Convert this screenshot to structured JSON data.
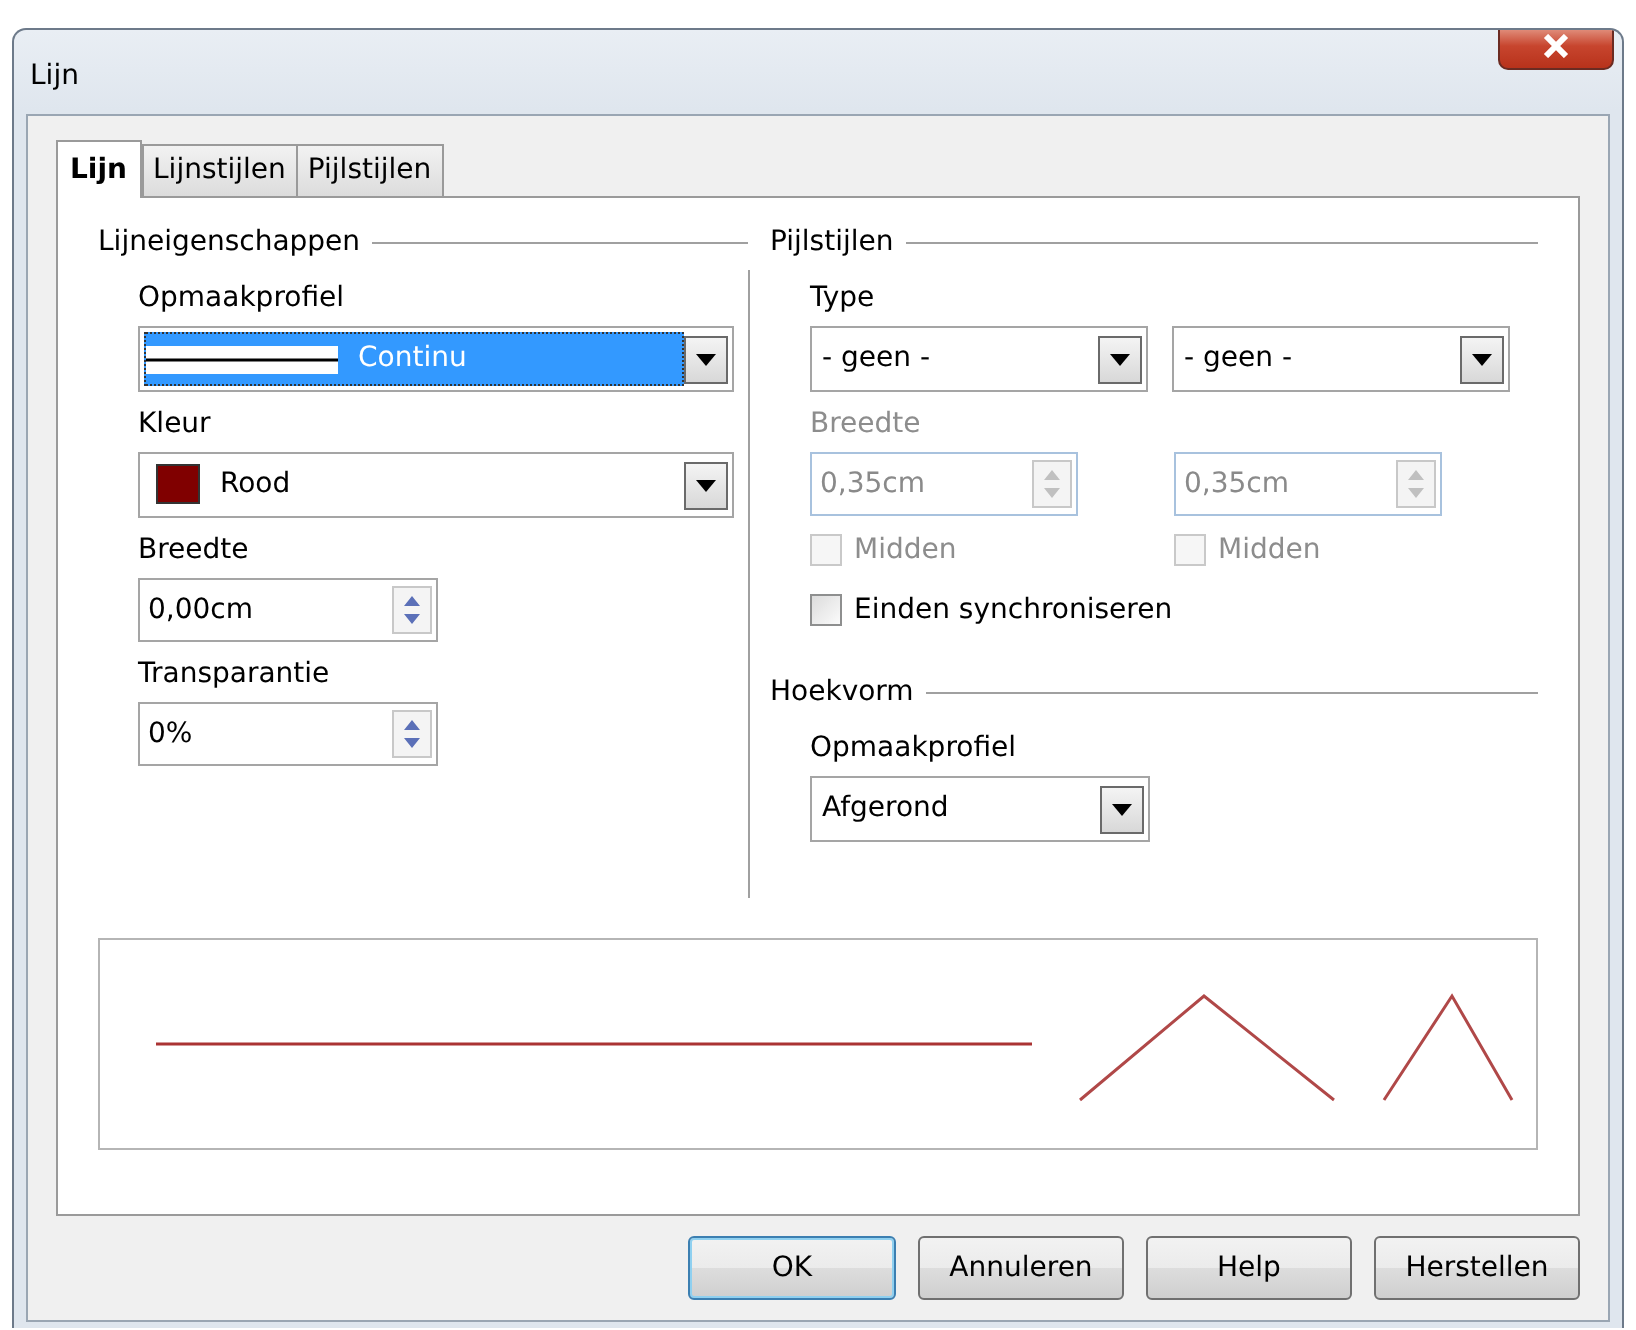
{
  "window": {
    "title": "Lijn"
  },
  "tabs": [
    {
      "label": "Lijn",
      "selected": true
    },
    {
      "label": "Lijnstijlen",
      "selected": false
    },
    {
      "label": "Pijlstijlen",
      "selected": false
    }
  ],
  "line_properties": {
    "heading": "Lijneigenschappen",
    "fields": [
      {
        "kind": "style-select",
        "label": "Opmaakprofiel",
        "value": "Continu",
        "focused": true
      },
      {
        "kind": "color-select",
        "label": "Kleur",
        "value": "Rood",
        "color": "#800000"
      },
      {
        "kind": "spin",
        "label": "Breedte",
        "value": "0,00cm"
      },
      {
        "kind": "spin",
        "label": "Transparantie",
        "value": "0%"
      }
    ]
  },
  "arrow_styles": {
    "heading": "Pijlstijlen",
    "type_label": "Type",
    "types": [
      "- geen -",
      "- geen -"
    ],
    "width_label": "Breedte",
    "width_disabled": true,
    "widths": [
      "0,35cm",
      "0,35cm"
    ],
    "center": [
      {
        "label": "Midden",
        "checked": false,
        "disabled": true
      },
      {
        "label": "Midden",
        "checked": false,
        "disabled": true
      }
    ],
    "sync": {
      "label": "Einden synchroniseren",
      "checked": false,
      "disabled": false
    }
  },
  "corner_style": {
    "heading": "Hoekvorm",
    "label": "Opmaakprofiel",
    "value": "Afgerond"
  },
  "buttons": [
    {
      "label": "OK",
      "default": true
    },
    {
      "label": "Annuleren",
      "default": false
    },
    {
      "label": "Help",
      "default": false
    },
    {
      "label": "Herstellen",
      "default": false
    }
  ]
}
